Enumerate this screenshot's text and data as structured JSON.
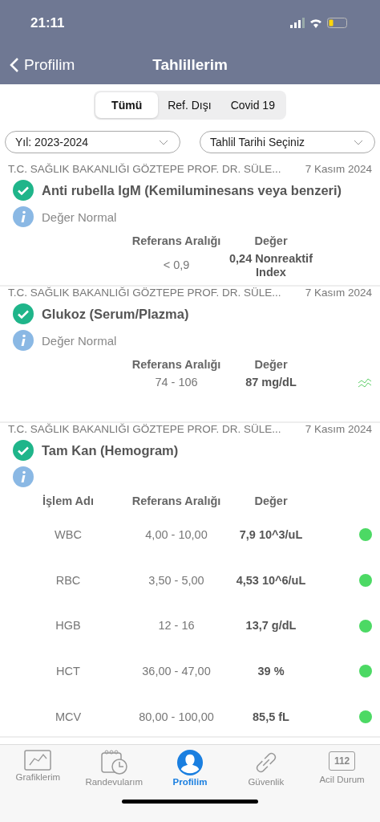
{
  "status_bar": {
    "time": "21:11"
  },
  "nav": {
    "back": "Profilim",
    "title": "Tahlillerim"
  },
  "tabs": [
    {
      "label": "Tümü",
      "selected": true
    },
    {
      "label": "Ref. Dışı",
      "selected": false
    },
    {
      "label": "Covid 19",
      "selected": false
    }
  ],
  "filters": [
    {
      "value": "Yıl: 2023-2024"
    },
    {
      "value": "Tahlil Tarihi Seçiniz"
    }
  ],
  "results": [
    {
      "hospital": "T.C. SAĞLIK BAKANLIĞI GÖZTEPE PROF. DR. SÜLE...",
      "date": "7 Kasım 2024",
      "name": "Anti rubella IgM (Kemiluminesans veya benzeri)",
      "note": "Değer Normal",
      "columns": [
        "Referans Aralığı",
        "Değer"
      ],
      "rows": [
        {
          "reference": "< 0,9",
          "value": "0,24 Nonreaktif Index"
        }
      ]
    },
    {
      "hospital": "T.C. SAĞLIK BAKANLIĞI GÖZTEPE PROF. DR. SÜLE...",
      "date": "7 Kasım 2024",
      "name": "Glukoz (Serum/Plazma)",
      "note": "Değer Normal",
      "columns": [
        "Referans Aralığı",
        "Değer"
      ],
      "rows": [
        {
          "reference": "74 - 106",
          "value": "87 mg/dL",
          "kind": "trend"
        }
      ]
    },
    {
      "hospital": "T.C. SAĞLIK BAKANLIĞI GÖZTEPE PROF. DR. SÜLE...",
      "date": "7 Kasım 2024",
      "name": "Tam Kan (Hemogram)",
      "name_column": "İşlem Adı",
      "columns": [
        "Referans Aralığı",
        "Değer"
      ],
      "rows": [
        {
          "test": "WBC",
          "reference": "4,00 - 10,00",
          "value": "7,9 10^3/uL",
          "kind": "dot",
          "color": "#4cd964"
        },
        {
          "test": "RBC",
          "reference": "3,50 - 5,00",
          "value": "4,53 10^6/uL",
          "kind": "dot",
          "color": "#4cd964"
        },
        {
          "test": "HGB",
          "reference": "12 - 16",
          "value": "13,7 g/dL",
          "kind": "dot",
          "color": "#4cd964"
        },
        {
          "test": "HCT",
          "reference": "36,00 - 47,00",
          "value": "39 %",
          "kind": "dot",
          "color": "#4cd964"
        },
        {
          "test": "MCV",
          "reference": "80,00 - 100,00",
          "value": "85,5 fL",
          "kind": "dot",
          "color": "#4cd964"
        }
      ]
    }
  ],
  "tab_bar": [
    {
      "label": "Grafiklerim",
      "kind": "chart",
      "selected": false
    },
    {
      "label": "Randevularım",
      "kind": "calendar",
      "selected": false
    },
    {
      "label": "Profilim",
      "kind": "person",
      "selected": true
    },
    {
      "label": "Güvenlik",
      "kind": "link",
      "selected": false
    },
    {
      "label": "Acil Durum",
      "kind": "badge",
      "icon_text": "112",
      "selected": false
    }
  ]
}
